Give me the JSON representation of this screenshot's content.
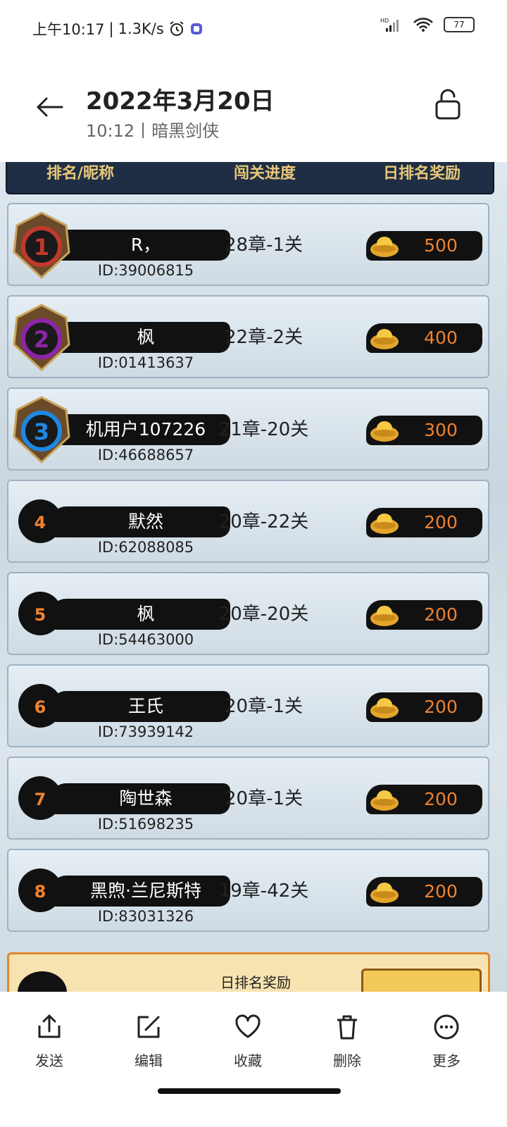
{
  "status_bar": {
    "time": "上午10:17",
    "speed": "1.3K/s",
    "hd": "HD",
    "battery": "77"
  },
  "header": {
    "title": "2022年3月20日",
    "subtitle": "10:12丨暗黑剑侠"
  },
  "columns": {
    "rank": "排名/昵称",
    "progress": "闯关进度",
    "reward": "日排名奖励"
  },
  "rows": [
    {
      "rank": "1",
      "name": "R，",
      "id": "ID:39006815",
      "progress": "28章-1关",
      "reward": "500"
    },
    {
      "rank": "2",
      "name": "枫",
      "id": "ID:01413637",
      "progress": "22章-2关",
      "reward": "400"
    },
    {
      "rank": "3",
      "name": "机用户107226",
      "id": "ID:46688657",
      "progress": "21章-20关",
      "reward": "300"
    },
    {
      "rank": "4",
      "name": "默然",
      "id": "ID:62088085",
      "progress": "20章-22关",
      "reward": "200"
    },
    {
      "rank": "5",
      "name": "枫",
      "id": "ID:54463000",
      "progress": "20章-20关",
      "reward": "200"
    },
    {
      "rank": "6",
      "name": "王氏",
      "id": "ID:73939142",
      "progress": "20章-1关",
      "reward": "200"
    },
    {
      "rank": "7",
      "name": "陶世森",
      "id": "ID:51698235",
      "progress": "20章-1关",
      "reward": "200"
    },
    {
      "rank": "8",
      "name": "黑煦·兰尼斯特",
      "id": "ID:83031326",
      "progress": "19章-42关",
      "reward": "200"
    }
  ],
  "my_rank": {
    "label": "日排名奖励"
  },
  "toolbar": {
    "send": "发送",
    "edit": "编辑",
    "favorite": "收藏",
    "delete": "删除",
    "more": "更多"
  },
  "colors": {
    "reward_text": "#f0822e",
    "header_bg": "#1f2e44",
    "header_text": "#e9c879",
    "rank1": "#c0392b",
    "rank2": "#8e24aa",
    "rank3": "#1e88e5"
  }
}
